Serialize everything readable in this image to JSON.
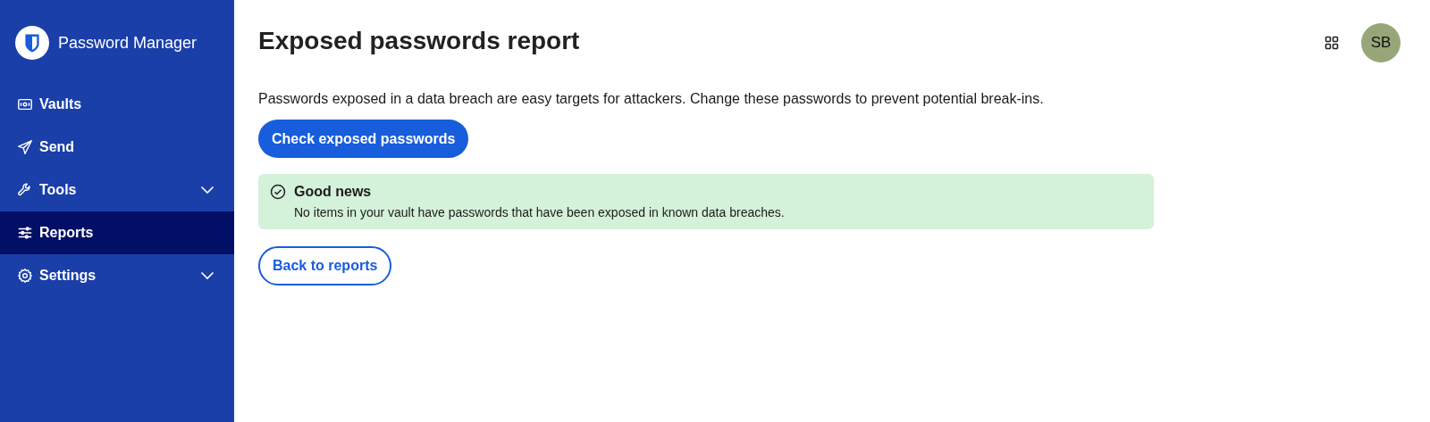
{
  "sidebar": {
    "brand": "Password Manager",
    "items": [
      {
        "label": "Vaults",
        "selected": false
      },
      {
        "label": "Send",
        "selected": false
      },
      {
        "label": "Tools",
        "selected": false,
        "expanded": false
      },
      {
        "label": "Reports",
        "selected": true
      },
      {
        "label": "Settings",
        "selected": false,
        "expanded": false
      }
    ]
  },
  "header": {
    "title": "Exposed passwords report",
    "avatar": "SB"
  },
  "description": "Passwords exposed in a data breach are easy targets for attackers. Change these passwords to prevent potential break-ins.",
  "check_button": "Check exposed passwords",
  "callout": {
    "title": "Good news",
    "message": "No items in your vault have passwords that have been exposed in known data breaches."
  },
  "back_button": "Back to reports"
}
